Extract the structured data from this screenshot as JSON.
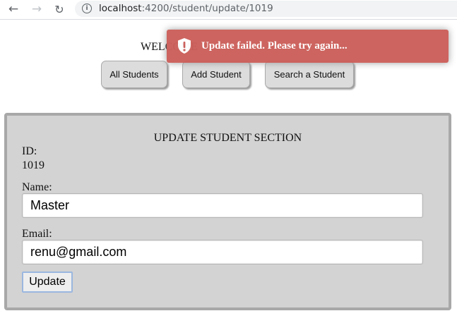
{
  "browser": {
    "back_icon": "arrow-left-icon",
    "forward_icon": "arrow-right-icon",
    "reload_icon": "reload-icon",
    "info_icon": "info-icon",
    "url_host": "localhost",
    "url_rest": ":4200/student/update/1019"
  },
  "header": {
    "welcome": "WELCOME",
    "nav": [
      "All Students",
      "Add Student",
      "Search a Student"
    ]
  },
  "toast": {
    "message": "Update failed. Please try again...",
    "color": "#cc5f5a",
    "icon": "shield-alert-icon"
  },
  "form": {
    "title": "UPDATE STUDENT SECTION",
    "id_label": "ID:",
    "id_value": "1019",
    "name_label": "Name:",
    "name_value": "Master",
    "email_label": "Email:",
    "email_value": "renu@gmail.com",
    "submit_label": "Update"
  }
}
